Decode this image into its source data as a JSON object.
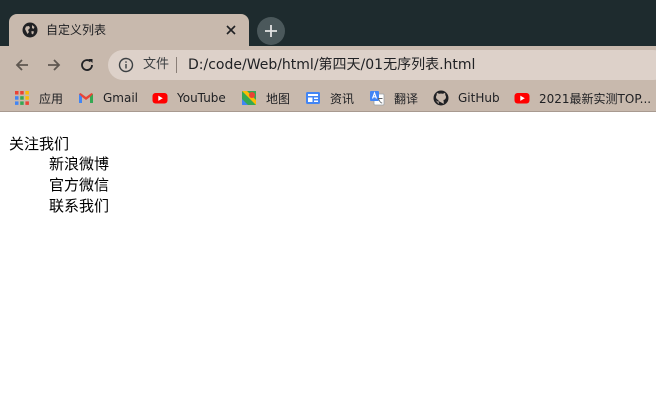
{
  "tab": {
    "title": "自定义列表"
  },
  "toolbar": {
    "scheme_label": "文件",
    "url": "D:/code/Web/html/第四天/01无序列表.html"
  },
  "bookmarks": [
    {
      "label": "应用",
      "icon": "apps-grid-icon"
    },
    {
      "label": "Gmail",
      "icon": "gmail-icon"
    },
    {
      "label": "YouTube",
      "icon": "youtube-icon"
    },
    {
      "label": "地图",
      "icon": "maps-icon"
    },
    {
      "label": "资讯",
      "icon": "news-icon"
    },
    {
      "label": "翻译",
      "icon": "translate-icon"
    },
    {
      "label": "GitHub",
      "icon": "github-icon"
    },
    {
      "label": "2021最新实测TOP...",
      "icon": "youtube-icon"
    }
  ],
  "page": {
    "heading": "关注我们",
    "items": [
      "新浪微博",
      "官方微信",
      "联系我们"
    ]
  },
  "colors": {
    "tabstrip": "#1e2b2e",
    "toolbar": "#c8b9ad",
    "omnibox": "#ddd1c9",
    "youtube_red": "#ff0000"
  }
}
